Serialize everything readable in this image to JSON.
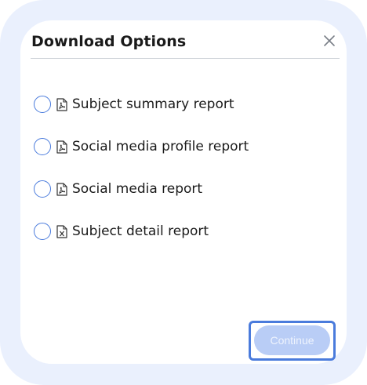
{
  "dialog": {
    "title": "Download Options",
    "close_icon": "close-icon"
  },
  "options": [
    {
      "label": "Subject summary report",
      "icon": "pdf-file-icon"
    },
    {
      "label": "Social media profile report",
      "icon": "pdf-file-icon"
    },
    {
      "label": "Social media report",
      "icon": "pdf-file-icon"
    },
    {
      "label": "Subject detail report",
      "icon": "excel-file-icon"
    }
  ],
  "footer": {
    "continue_label": "Continue"
  },
  "colors": {
    "accent": "#4a7bdc",
    "button_disabled": "#b9cdf6",
    "frame": "#eaf0fd"
  }
}
